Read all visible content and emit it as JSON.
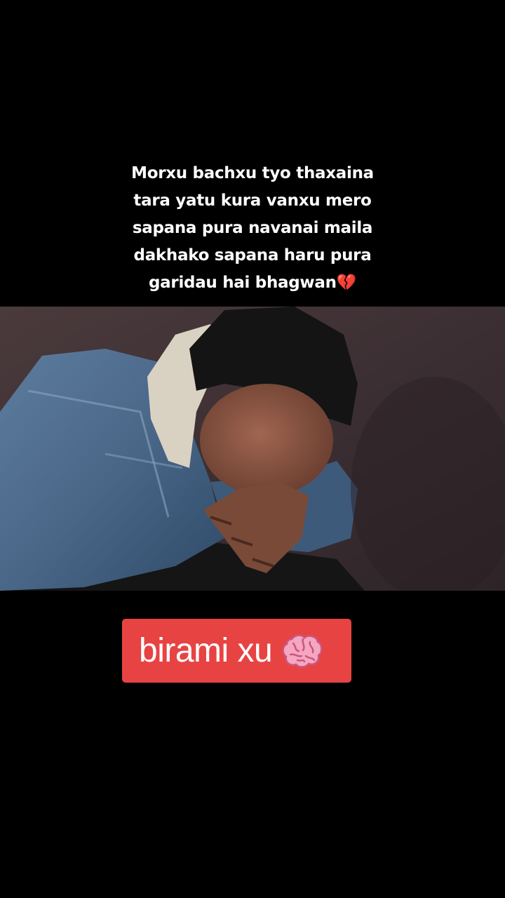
{
  "caption": {
    "lines": [
      "Morxu bachxu tyo thaxaina",
      "tara yatu kura vanxu mero",
      "sapana pura navanai maila",
      "dakhako sapana haru pura",
      "garidau hai bhagwan💔"
    ]
  },
  "photo": {
    "icon": "photo-crying-boy"
  },
  "sticker": {
    "text": "birami xu",
    "icon": "brain-icon",
    "background": "#e84343"
  }
}
